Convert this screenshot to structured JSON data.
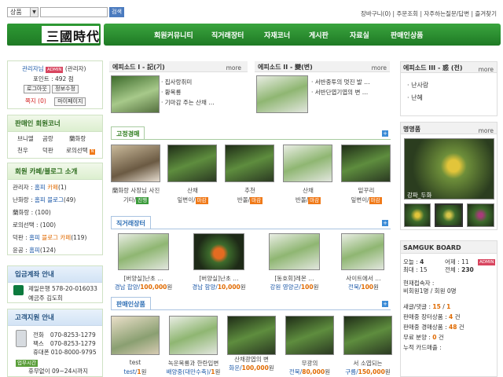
{
  "top": {
    "search_select": "상품",
    "search_button": "검색",
    "links": "장바구니(0) | 주문조회 | 자주하는질문/답변 | 즐겨찾기"
  },
  "logo": {
    "text": "三國時代"
  },
  "nav": [
    "회원커뮤니티",
    "직거래장터",
    "자재코너",
    "게시판",
    "자료실",
    "판매인상품"
  ],
  "login": {
    "name": "관리자님",
    "badge": "ADMIN",
    "role": "(관리자)",
    "points": "포인트 : 492 점",
    "logout": "로그아웃",
    "edit": "정보수정",
    "note": "쪽지 (0)",
    "mypage": "마이페이지"
  },
  "seller_corner": {
    "title": "판매인 회원코너",
    "items": [
      "브니엘",
      "곰랑",
      "蘭화랑",
      "천우",
      "덕판",
      "로의선택"
    ]
  },
  "cafe": {
    "title": "회원 카페/블로그 소개",
    "rows": [
      [
        "관리자 : ",
        "홈피",
        " 카페",
        "(1)"
      ],
      [
        "난화랑 : ",
        "홈피",
        " 블로그",
        "(49)"
      ],
      [
        "蘭화랑 : ",
        "",
        "",
        "(100)"
      ],
      [
        "로의선택 : ",
        "",
        "",
        "(100)"
      ],
      [
        "덕판 : ",
        "홈피",
        " 블로그 카페",
        "(119)"
      ],
      [
        "윤공 : ",
        "홈피",
        "",
        "(124)"
      ]
    ]
  },
  "bank": {
    "title": "입금계좌 안내",
    "line1": "제일은행 578-20-016033",
    "line2": "예금주 김도희"
  },
  "support": {
    "title": "고객지원 안내",
    "phone_label": "전화",
    "phone": "070-8253-1279",
    "fax_label": "팩스",
    "fax": "070-8253-1279",
    "mobile_label": "휴대폰",
    "mobile": "010-8000-9795",
    "hours_label": "업무시간",
    "hours": "휴무없이 09~24시까지"
  },
  "episodes": [
    {
      "title": "에피소드 I - 記(기)",
      "more": "more",
      "items": [
        "집사랑취미",
        "황복룡",
        "기마감 주는 산채 …"
      ]
    },
    {
      "title": "에피소드 II - 變(변)",
      "more": "more",
      "items": [
        "서반중투의 멋진 발 …",
        "서반단엽기엽의 변 …"
      ]
    },
    {
      "title": "에피소드 III - 惑 (전)",
      "more": "more",
      "items": [
        "난사랑",
        "난혜"
      ]
    }
  ],
  "auction": {
    "tab": "고정경매",
    "items": [
      {
        "name": "蘭화랑 사장님 사진",
        "sub": "기타/",
        "badge": "진행"
      },
      {
        "name": "산채",
        "sub": "잎변이/",
        "badge": "마감"
      },
      {
        "name": "추천",
        "sub": "반몰/",
        "badge": "마감"
      },
      {
        "name": "산채",
        "sub": "반몰/",
        "badge": "마감"
      },
      {
        "name": "밑꾸리",
        "sub": "잎변이/",
        "badge": "마감"
      }
    ]
  },
  "direct": {
    "tab": "직거래장터",
    "items": [
      {
        "name": "[버양실]난초 …",
        "price_pre": "경남 합양/",
        "price": "100,000",
        "unit": "원"
      },
      {
        "name": "[버양실]난초 …",
        "price_pre": "경남 함양/",
        "price": "10,000",
        "unit": "원"
      },
      {
        "name": "[동호회]레몬 …",
        "price_pre": "강원 영양군/",
        "price": "100",
        "unit": "원"
      },
      {
        "name": "사이트에서 …",
        "price_pre": "전북/",
        "price": "100",
        "unit": "원"
      }
    ]
  },
  "seller_products": {
    "tab": "판매인상품",
    "items": [
      {
        "name": "test",
        "price_pre": "test/",
        "price": "1",
        "unit": "원"
      },
      {
        "name": "녹운복룡과 한란입변",
        "price_pre": "배양중(대만수축)/",
        "price": "1",
        "unit": "원"
      },
      {
        "name": "산채광엽의 변",
        "price_pre": "화운/",
        "price": "100,000",
        "unit": "원"
      },
      {
        "name": "무광의",
        "price_pre": "전북/",
        "price": "80,000",
        "unit": "원"
      },
      {
        "name": "서 소엽되는",
        "price_pre": "구름/",
        "price": "150,000",
        "unit": "원"
      }
    ]
  },
  "famous": {
    "title": "명명품",
    "more": "more",
    "caption": "강파_두화"
  },
  "board": {
    "title": "SAMGUK BOARD",
    "today_label": "오늘 : ",
    "today": "4",
    "yesterday_label": "어제 : ",
    "yesterday": "11",
    "badge": "ADMIN",
    "max_label": "최대 : ",
    "max": "15",
    "total_label": "전체 : ",
    "total": "230",
    "current_label": "현재접속자 :",
    "current_line": "비회원1명 / 회원 0명",
    "new_label": "새글/댓글 : ",
    "new_posts": "15",
    "new_sep": " / ",
    "new_comments": "1",
    "market_label": "판매중 장터상품 : ",
    "market": "4",
    "market_unit": " 건",
    "auction_label": "판매중 경매상품 : ",
    "auction": "48",
    "auction_unit": " 건",
    "free_label": "무료 분양 : ",
    "free": "0",
    "free_unit": " 건",
    "card_label": "누적 카드매출 :"
  }
}
